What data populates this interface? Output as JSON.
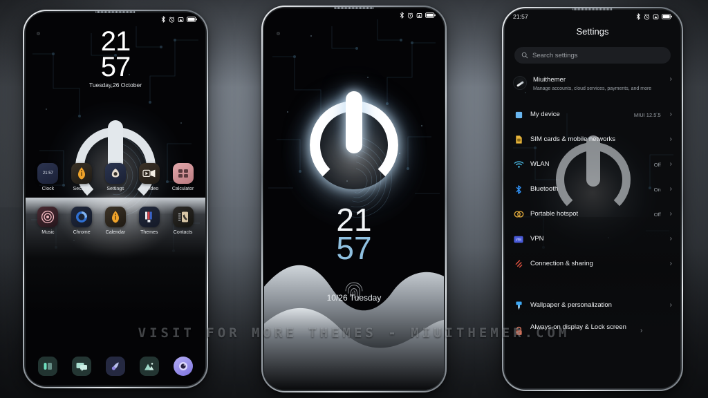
{
  "theme": {
    "accent_blue": "#8fc0e0",
    "backdrop": "#6b727b",
    "screen_bg": "#040406",
    "glyph": "#e3e8ec"
  },
  "watermark": {
    "text": "VISIT  FOR  MORE  THEMES  -  MIUITHEMER.COM"
  },
  "status_bar": {
    "time": "21:57",
    "icons": [
      "bluetooth-icon",
      "alarm-icon",
      "vibrate-icon",
      "battery-icon"
    ]
  },
  "phone1": {
    "name": "home-screen",
    "clock": {
      "hours": "21",
      "minutes": "57"
    },
    "date": "Tuesday,26 October",
    "app_rows": [
      [
        {
          "label": "Clock",
          "icon": "clock-app-icon",
          "badge": "21:57"
        },
        {
          "label": "Security",
          "icon": "security-app-icon"
        },
        {
          "label": "Settings",
          "icon": "settings-app-icon"
        },
        {
          "label": "Mi Video",
          "icon": "mi-video-app-icon"
        },
        {
          "label": "Calculator",
          "icon": "calculator-app-icon"
        }
      ],
      [
        {
          "label": "Music",
          "icon": "music-app-icon"
        },
        {
          "label": "Chrome",
          "icon": "chrome-app-icon"
        },
        {
          "label": "Calendar",
          "icon": "calendar-app-icon"
        },
        {
          "label": "Themes",
          "icon": "themes-app-icon"
        },
        {
          "label": "Contacts",
          "icon": "contacts-app-icon"
        }
      ]
    ],
    "dock": [
      {
        "label": "Phone",
        "icon": "phone-dock-icon"
      },
      {
        "label": "Messages",
        "icon": "messages-dock-icon"
      },
      {
        "label": "Browser",
        "icon": "browser-dock-icon"
      },
      {
        "label": "Gallery",
        "icon": "gallery-dock-icon"
      },
      {
        "label": "Camera",
        "icon": "camera-dock-icon"
      }
    ]
  },
  "phone2": {
    "name": "lock-screen",
    "clock": {
      "hours": "21",
      "minutes": "57"
    },
    "date": "10/26 Tuesday",
    "fingerprint": "fingerprint-icon"
  },
  "phone3": {
    "name": "settings-screen",
    "title": "Settings",
    "search": {
      "placeholder": "Search settings",
      "icon": "search-icon"
    },
    "account": {
      "name": "Miuithemer",
      "subtitle": "Manage accounts, cloud services, payments, and more",
      "icon": "avatar"
    },
    "items": [
      {
        "label": "My device",
        "value": "MIUI 12.5.5",
        "icon": "device-icon",
        "color": "#5aa9e8"
      },
      {
        "label": "SIM cards & mobile networks",
        "value": "",
        "icon": "sim-icon",
        "color": "#e8b53b"
      },
      {
        "label": "WLAN",
        "value": "Off",
        "icon": "wifi-icon",
        "color": "#49b6e0"
      },
      {
        "label": "Bluetooth",
        "value": "On",
        "icon": "bluetooth-icon",
        "color": "#2f8ef0"
      },
      {
        "label": "Portable hotspot",
        "value": "Off",
        "icon": "hotspot-icon",
        "color": "#d9a43a"
      },
      {
        "label": "VPN",
        "value": "",
        "icon": "vpn-icon",
        "color": "#4a5bd8"
      },
      {
        "label": "Connection & sharing",
        "value": "",
        "icon": "connection-sharing-icon",
        "color": "#d9503f"
      },
      {
        "label": "Wallpaper & personalization",
        "value": "",
        "icon": "wallpaper-icon",
        "color": "#3fa9f5"
      },
      {
        "label": "Always-on display & Lock screen",
        "value": "",
        "icon": "lock-icon",
        "color": "#e07a62"
      }
    ],
    "chevron": "›"
  }
}
